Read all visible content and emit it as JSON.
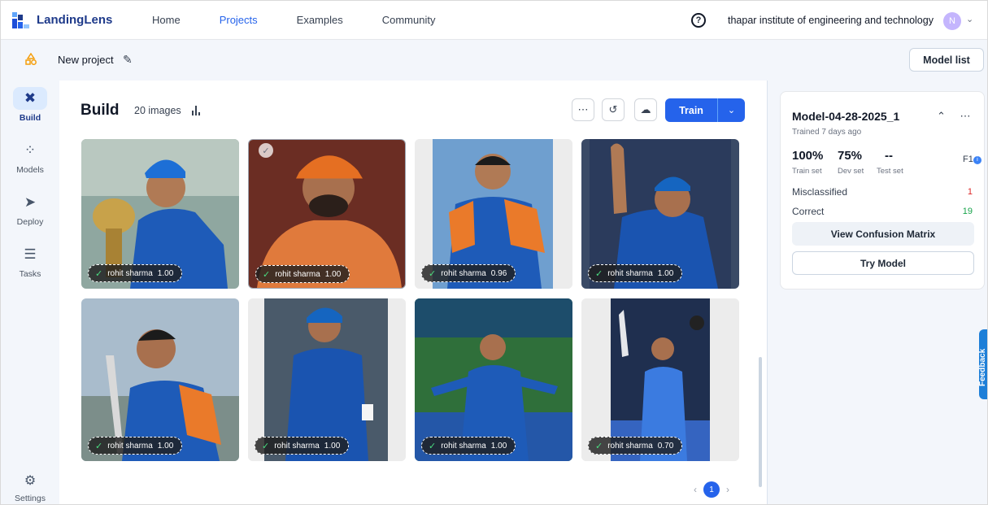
{
  "app": {
    "name": "LandingLens"
  },
  "nav": {
    "items": [
      {
        "label": "Home",
        "active": false
      },
      {
        "label": "Projects",
        "active": true
      },
      {
        "label": "Examples",
        "active": false
      },
      {
        "label": "Community",
        "active": false
      }
    ],
    "org_name": "thapar institute of engineering and technology",
    "avatar_initial": "N"
  },
  "project": {
    "name": "New project",
    "model_list_label": "Model list"
  },
  "sidebar": {
    "items": [
      {
        "label": "Build",
        "icon": "tools-icon",
        "active": true
      },
      {
        "label": "Models",
        "icon": "models-icon",
        "active": false
      },
      {
        "label": "Deploy",
        "icon": "rocket-icon",
        "active": false
      },
      {
        "label": "Tasks",
        "icon": "tasks-icon",
        "active": false
      }
    ],
    "settings_label": "Settings"
  },
  "build": {
    "title": "Build",
    "image_count": "20 images",
    "train_label": "Train",
    "page": "1",
    "images": [
      {
        "label": "rohit sharma",
        "score": "1.00",
        "selected": false
      },
      {
        "label": "rohit sharma",
        "score": "1.00",
        "selected": true
      },
      {
        "label": "rohit sharma",
        "score": "0.96",
        "selected": false
      },
      {
        "label": "rohit sharma",
        "score": "1.00",
        "selected": false
      },
      {
        "label": "rohit sharma",
        "score": "1.00",
        "selected": false
      },
      {
        "label": "rohit sharma",
        "score": "1.00",
        "selected": false
      },
      {
        "label": "rohit sharma",
        "score": "1.00",
        "selected": false
      },
      {
        "label": "rohit sharma",
        "score": "0.70",
        "selected": false
      }
    ]
  },
  "model": {
    "name": "Model-04-28-2025_1",
    "trained": "Trained 7 days ago",
    "metrics": [
      {
        "value": "100%",
        "label": "Train set"
      },
      {
        "value": "75%",
        "label": "Dev set"
      },
      {
        "value": "--",
        "label": "Test set"
      }
    ],
    "metric_name": "F1",
    "misclassified_label": "Misclassified",
    "misclassified_value": "1",
    "correct_label": "Correct",
    "correct_value": "19",
    "confusion_matrix_label": "View Confusion Matrix",
    "try_model_label": "Try Model"
  },
  "feedback_label": "Feedback",
  "colors": {
    "accent": "#2563eb",
    "misclassified": "#dc2626",
    "correct": "#16a34a",
    "jersey_blue": "#1e5bb8",
    "jersey_orange": "#ea7a2a"
  }
}
